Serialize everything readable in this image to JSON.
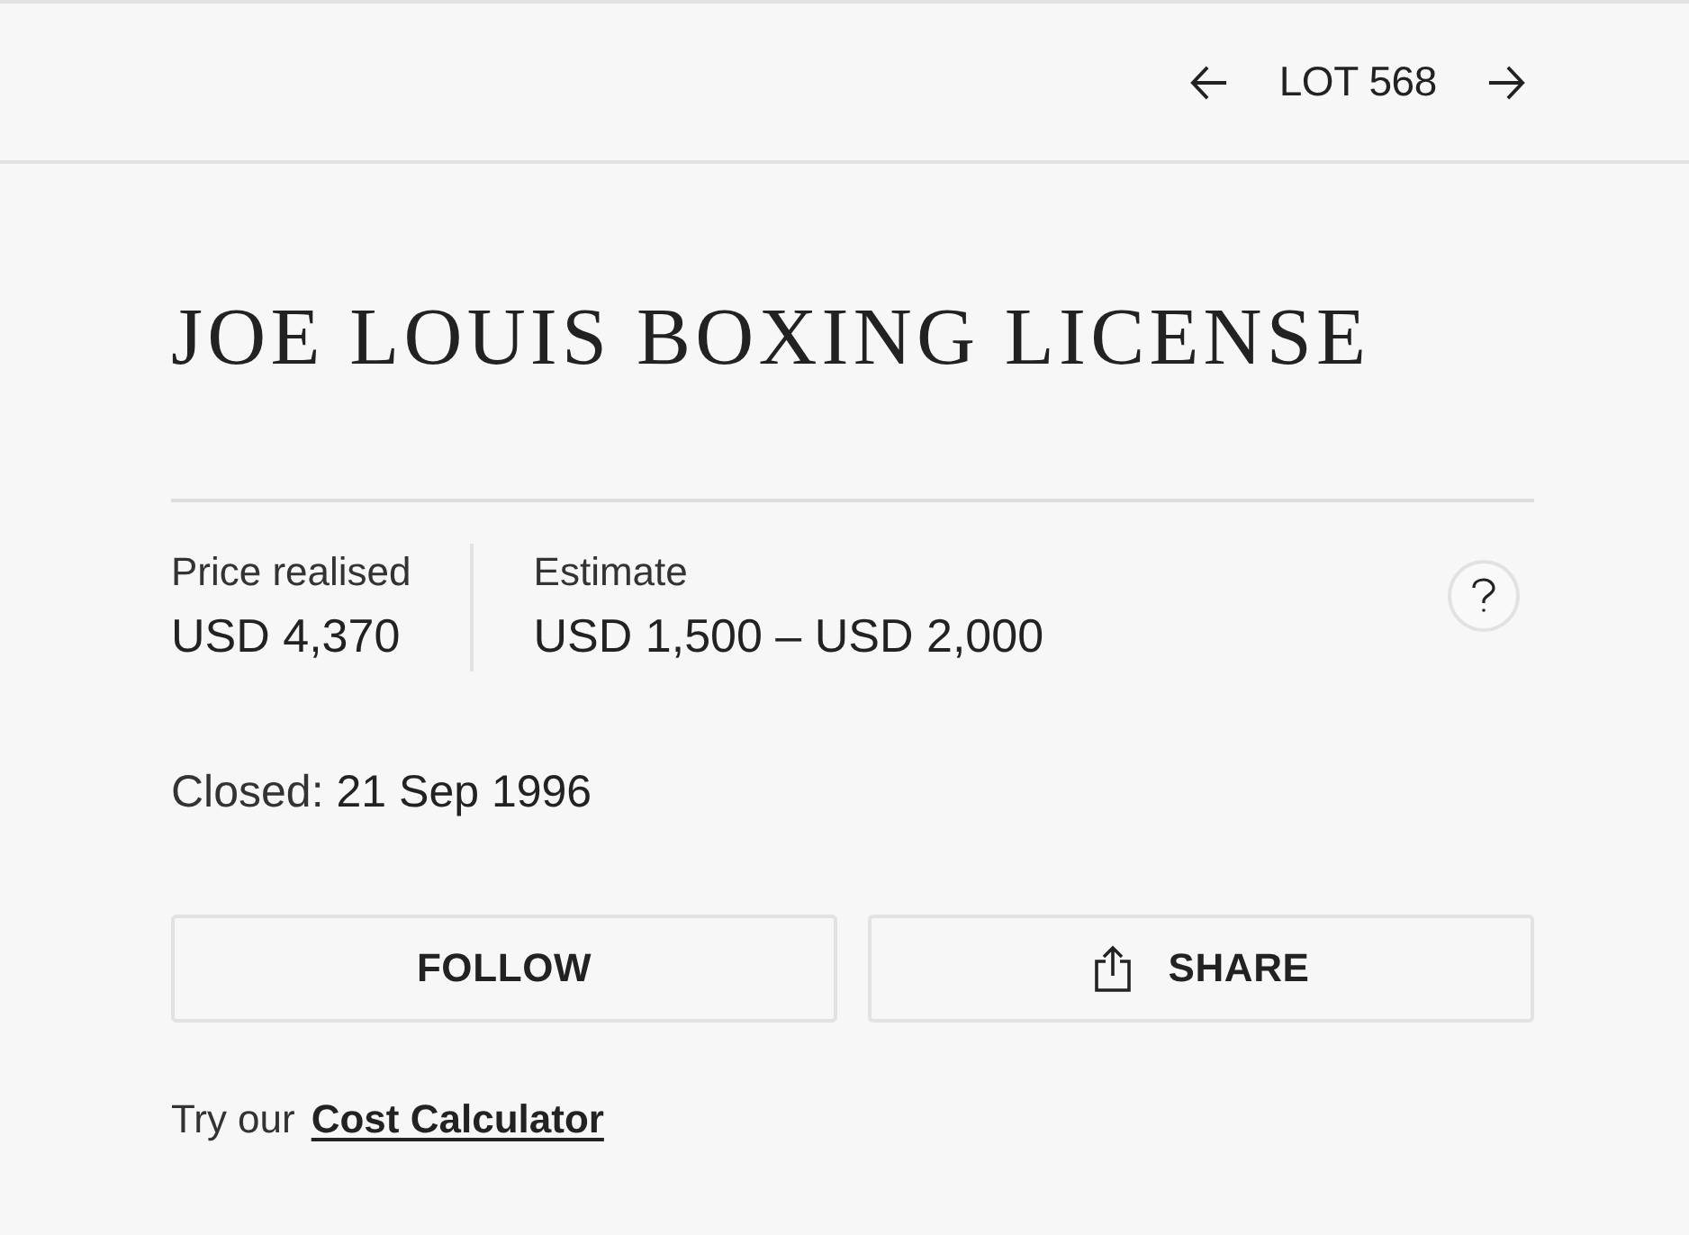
{
  "header": {
    "lot_label": "LOT 568"
  },
  "title": "JOE LOUIS BOXING LICENSE",
  "prices": [
    {
      "label": "Price realised",
      "value": "USD 4,370"
    },
    {
      "label": "Estimate",
      "value": "USD 1,500 – USD 2,000"
    }
  ],
  "closed": {
    "label": "Closed:",
    "value": "21 Sep 1996"
  },
  "buttons": [
    {
      "kind": "follow",
      "label": "FOLLOW"
    },
    {
      "kind": "share",
      "label": "SHARE"
    }
  ],
  "calculator": {
    "text": "Try our",
    "link": "Cost Calculator"
  }
}
